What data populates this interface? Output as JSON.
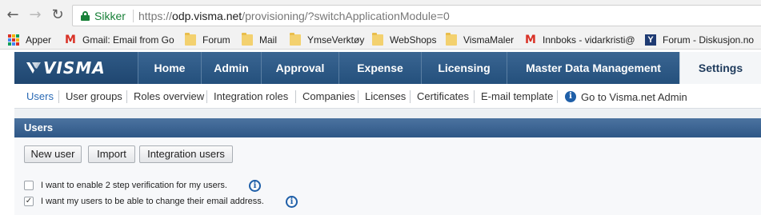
{
  "browser": {
    "secure_label": "Sikker",
    "url_scheme": "https://",
    "url_host": "odp.visma.net",
    "url_path": "/provisioning/?switchApplicationModule=0",
    "bookmarks": [
      {
        "label": "Apper",
        "icon": "apps-icon"
      },
      {
        "label": "Gmail: Email from Go",
        "icon": "gmail-icon"
      },
      {
        "label": "Forum",
        "icon": "folder-icon"
      },
      {
        "label": "Mail",
        "icon": "folder-icon"
      },
      {
        "label": "YmseVerktøy",
        "icon": "folder-icon"
      },
      {
        "label": "WebShops",
        "icon": "folder-icon"
      },
      {
        "label": "VismaMaler",
        "icon": "folder-icon"
      },
      {
        "label": "Innboks - vidarkristi@",
        "icon": "gmail-icon"
      },
      {
        "label": "Forum - Diskusjon.no",
        "icon": "forum-icon"
      }
    ]
  },
  "app": {
    "logo_text": "VISMA",
    "top_nav": [
      "Home",
      "Admin",
      "Approval",
      "Expense",
      "Licensing",
      "Master Data Management",
      "Settings"
    ],
    "active_top_nav": "Settings",
    "sub_nav": [
      "Users",
      "User groups",
      "Roles overview",
      "Integration roles",
      "Companies",
      "Licenses",
      "Certificates",
      "E-mail template"
    ],
    "active_sub_nav": "Users",
    "admin_link": "Go to Visma.net Admin"
  },
  "panel": {
    "title": "Users",
    "buttons": [
      "New user",
      "Import",
      "Integration users"
    ],
    "options": [
      {
        "label": "I want to enable 2 step verification for my users.",
        "checked": false
      },
      {
        "label": "I want my users to be able to change their email address.",
        "checked": true
      }
    ]
  },
  "colors": {
    "header_blue": "#24507c",
    "link_blue": "#2a6ab5",
    "secure_green": "#188038"
  }
}
